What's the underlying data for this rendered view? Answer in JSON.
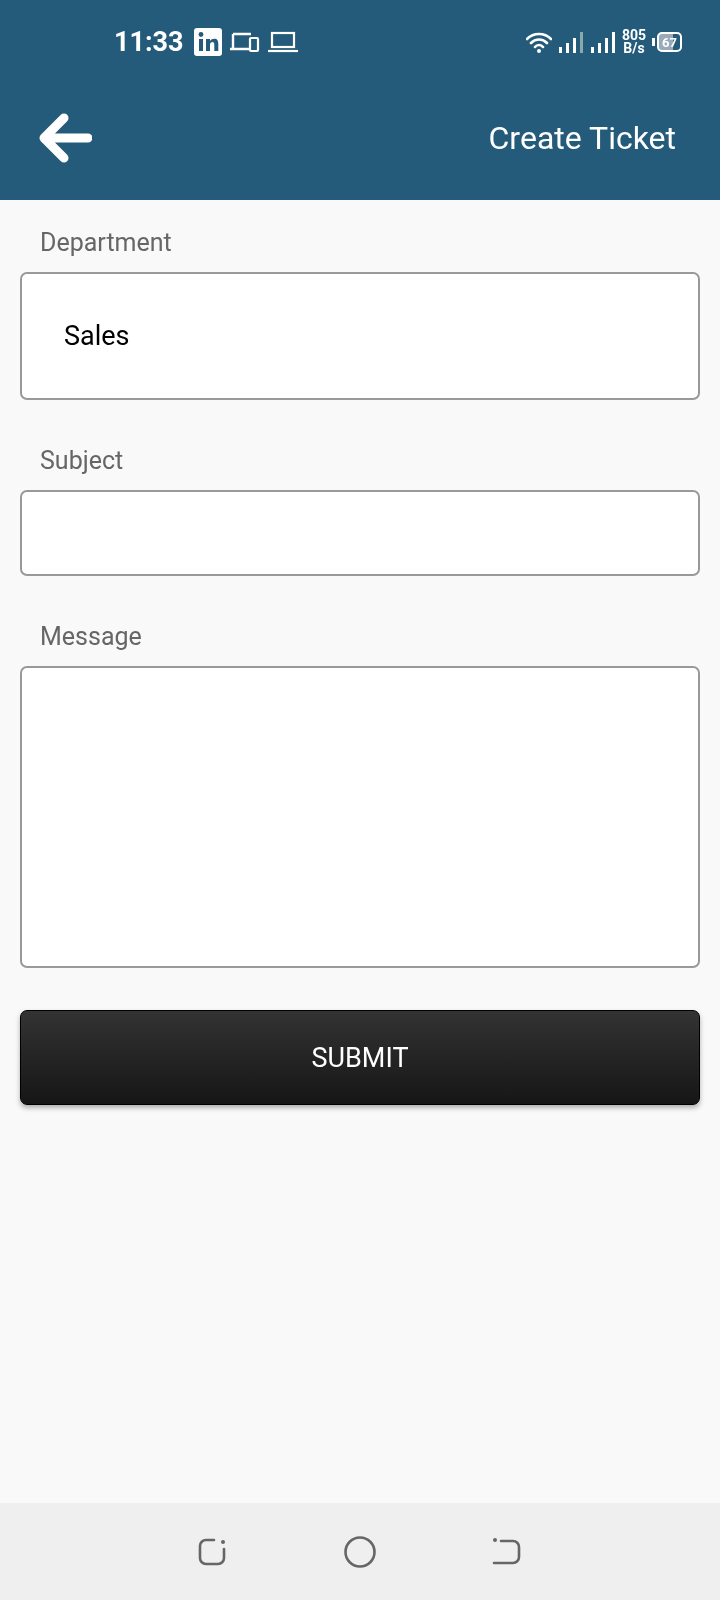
{
  "status_bar": {
    "time": "11:33",
    "net_speed": "805",
    "net_speed_unit": "B/s",
    "battery": "67"
  },
  "app_bar": {
    "title": "Create Ticket"
  },
  "fields": [
    {
      "label": "Department",
      "kind": "select",
      "value": "Sales"
    },
    {
      "label": "Subject",
      "kind": "input"
    },
    {
      "label": "Message",
      "kind": "textarea"
    }
  ],
  "submit_button": {
    "label": "SUBMIT"
  }
}
